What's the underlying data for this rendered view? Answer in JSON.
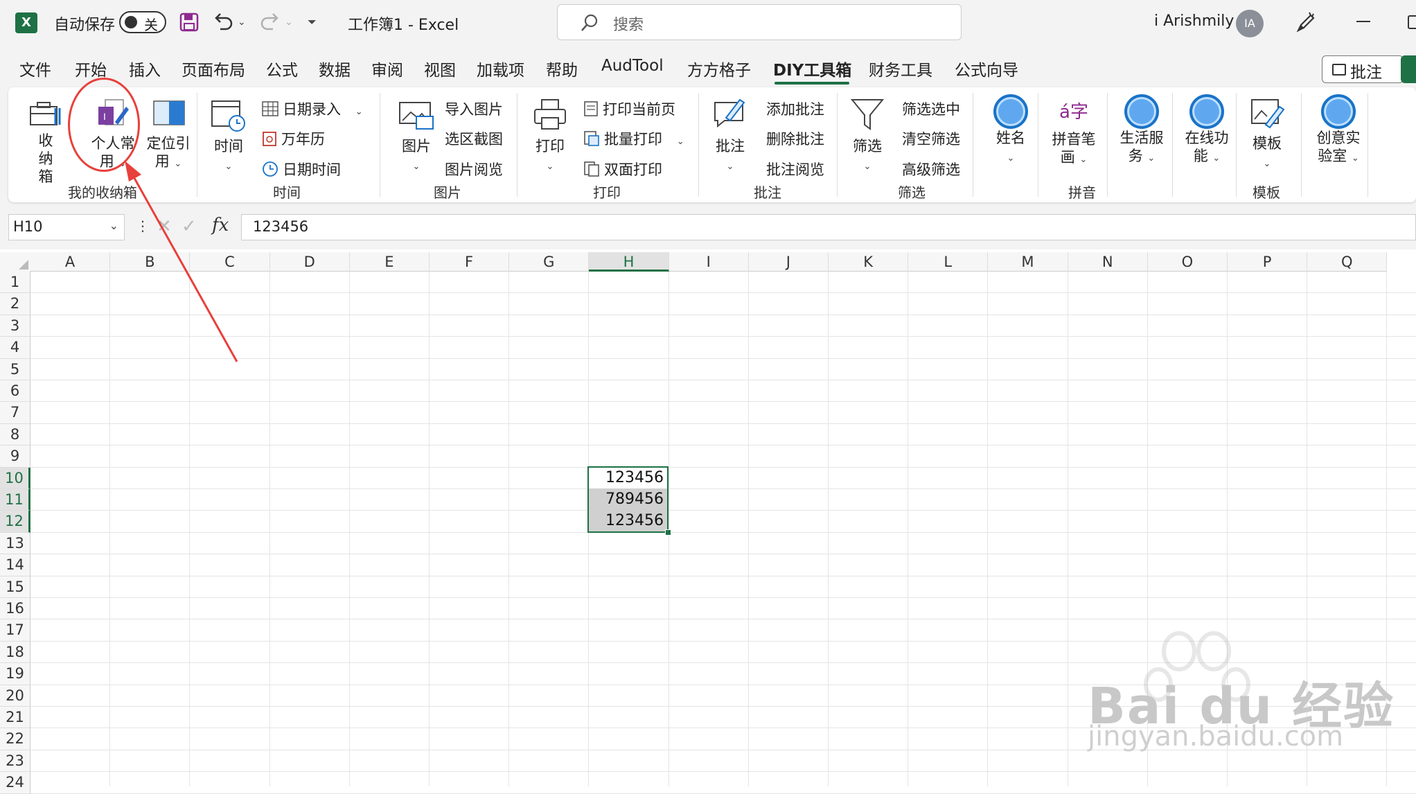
{
  "titlebar": {
    "app_icon": "X",
    "autosave_label": "自动保存",
    "autosave_state": "关",
    "doc_title": "工作簿1  -  Excel",
    "search_placeholder": "搜索",
    "user_name": "i Arishmily",
    "avatar_initials": "IA"
  },
  "menu": {
    "tabs": [
      "文件",
      "开始",
      "插入",
      "页面布局",
      "公式",
      "数据",
      "审阅",
      "视图",
      "加载项",
      "帮助",
      "AudTool",
      "方方格子",
      "DIY工具箱",
      "财务工具",
      "公式向导"
    ],
    "active_tab": "DIY工具箱",
    "comments_button": "批注"
  },
  "ribbon": {
    "groups": {
      "storage": {
        "label": "我的收纳箱",
        "storage_box": "收纳箱",
        "personal_common": "个人常用",
        "locate_ref": "定位引用"
      },
      "time": {
        "label": "时间",
        "time_btn": "时间",
        "date_entry": "日期录入",
        "calendar": "万年历",
        "datetime": "日期时间"
      },
      "picture": {
        "label": "图片",
        "picture_btn": "图片",
        "import_picture": "导入图片",
        "select_screenshot": "选区截图",
        "picture_browse": "图片阅览"
      },
      "print": {
        "label": "打印",
        "print_btn": "打印",
        "print_current": "打印当前页",
        "batch_print": "批量打印",
        "duplex_print": "双面打印"
      },
      "comment": {
        "label": "批注",
        "comment_btn": "批注",
        "add_comment": "添加批注",
        "delete_comment": "删除批注",
        "browse_comment": "批注阅览"
      },
      "filter": {
        "label": "筛选",
        "filter_btn": "筛选",
        "filter_selected": "筛选选中",
        "clear_filter": "清空筛选",
        "advanced_filter": "高级筛选"
      },
      "name": {
        "name_btn": "姓名"
      },
      "pinyin": {
        "label": "拼音",
        "pinyin_btn": "拼音笔画",
        "pinyin_glyph": "á字"
      },
      "life": {
        "life_btn": "生活服务"
      },
      "online": {
        "online_btn": "在线功能"
      },
      "template": {
        "label": "模板",
        "template_btn": "模板"
      },
      "creative": {
        "creative_btn": "创意实验室"
      }
    }
  },
  "formula_bar": {
    "name_box": "H10",
    "fx_label": "fx",
    "formula_value": "123456"
  },
  "sheet": {
    "columns": [
      "A",
      "B",
      "C",
      "D",
      "E",
      "F",
      "G",
      "H",
      "I",
      "J",
      "K",
      "L",
      "M",
      "N",
      "O",
      "P",
      "Q"
    ],
    "selected_column": "H",
    "rows": [
      "1",
      "2",
      "3",
      "4",
      "5",
      "6",
      "7",
      "8",
      "9",
      "10",
      "11",
      "12",
      "13",
      "14",
      "15",
      "16",
      "17",
      "18",
      "19",
      "20",
      "21",
      "22",
      "23",
      "24"
    ],
    "selected_rows": [
      "10",
      "11",
      "12"
    ],
    "cells": [
      {
        "ref": "H10",
        "value": "123456"
      },
      {
        "ref": "H11",
        "value": "789456"
      },
      {
        "ref": "H12",
        "value": "123456"
      }
    ]
  },
  "watermark": {
    "brand": "Bai du 经验",
    "url": "jingyan.baidu.com"
  },
  "colors": {
    "excel_green": "#1e7145",
    "annotation_red": "#e8403b",
    "selection_shade": "#d0d0d0"
  }
}
